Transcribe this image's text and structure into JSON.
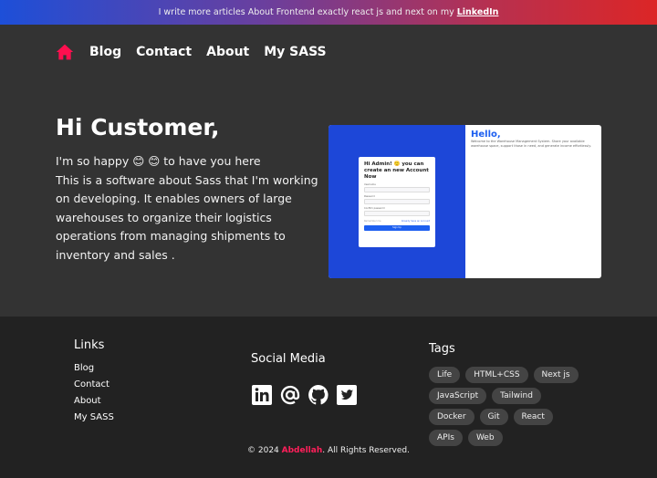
{
  "banner": {
    "text": "I write more articles About Frontend exactly react js and next on my",
    "link": "LinkedIn"
  },
  "nav": {
    "home_icon": "home-icon",
    "home_color": "#ff0f4f",
    "items": [
      "Blog",
      "Contact",
      "About",
      "My SASS"
    ]
  },
  "hero": {
    "title": "Hi Customer,",
    "line1": "I'm so happy 😊 😊 to have you here",
    "body": "This is a software about Sass that I'm working on developing. It enables owners of large warehouses to organize their logistics operations from managing shipments to inventory and sales ."
  },
  "screenshot": {
    "card_title": "Hi Admin! 🙂 you can create an new Account Now",
    "username": "Username",
    "password": "Password",
    "confirm": "Confirm password",
    "remember": "Remember me",
    "have_account": "Already have an Account",
    "signup": "Sign Up",
    "hello": "Hello,",
    "welcome": "Welcome to the Warehouse Management System. Share your available warehouse space, support those in need, and generate income effortlessly."
  },
  "footer": {
    "links_title": "Links",
    "links": [
      "Blog",
      "Contact",
      "About",
      "My SASS"
    ],
    "social_title": "Social Media",
    "social": [
      "linkedin-icon",
      "at-icon",
      "github-icon",
      "twitter-icon"
    ],
    "tags_title": "Tags",
    "tags": [
      "Life",
      "HTML+CSS",
      "Next js",
      "JavaScript",
      "Tailwind",
      "Docker",
      "Git",
      "React",
      "APIs",
      "Web"
    ],
    "copy_pre": "© 2024",
    "copy_name": "Abdellah",
    "copy_post": ". All Rights Reserved."
  }
}
